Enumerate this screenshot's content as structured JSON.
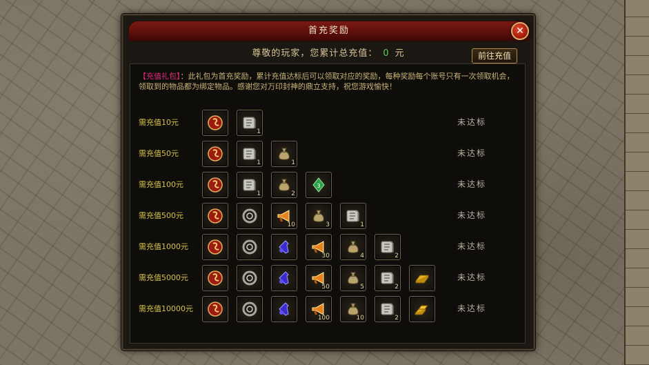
{
  "window": {
    "title": "首充奖励",
    "close_glyph": "✕"
  },
  "summary": {
    "prefix": "尊敬的玩家，您累计总充值：",
    "amount": "0",
    "unit": "元"
  },
  "recharge_button": "前往充值",
  "notice": {
    "tag": "【充值礼包】",
    "text": "：此礼包为首充奖励，累计充值达标后可以领取对应的奖励，每种奖励每个账号只有一次领取机会，领取到的物品都为绑定物品。感谢您对万印封神的鼎立支持，祝您游戏愉快！"
  },
  "colors": {
    "accent_gold": "#d6c44a",
    "highlight_magenta": "#e0287a",
    "amount_green": "#4fd04f",
    "title_red": "#7a1a12"
  },
  "tiers": [
    {
      "req": "需充值10元",
      "status": "未达标",
      "items": [
        {
          "icon": "dragon-seal-icon",
          "count": ""
        },
        {
          "icon": "scroll-icon",
          "count": "1"
        }
      ]
    },
    {
      "req": "需充值50元",
      "status": "未达标",
      "items": [
        {
          "icon": "dragon-seal-icon",
          "count": ""
        },
        {
          "icon": "scroll-icon",
          "count": "1"
        },
        {
          "icon": "money-bag-icon",
          "count": "1"
        }
      ]
    },
    {
      "req": "需充值100元",
      "status": "未达标",
      "items": [
        {
          "icon": "dragon-seal-icon",
          "count": ""
        },
        {
          "icon": "scroll-icon",
          "count": "1"
        },
        {
          "icon": "money-bag-icon",
          "count": "2"
        },
        {
          "icon": "green-gem-icon",
          "count": ""
        }
      ]
    },
    {
      "req": "需充值500元",
      "status": "未达标",
      "items": [
        {
          "icon": "dragon-seal-icon",
          "count": ""
        },
        {
          "icon": "ring-icon",
          "count": ""
        },
        {
          "icon": "horn-icon",
          "count": "10"
        },
        {
          "icon": "money-bag-icon",
          "count": "3"
        },
        {
          "icon": "scroll-icon",
          "count": "1"
        }
      ]
    },
    {
      "req": "需充值1000元",
      "status": "未达标",
      "items": [
        {
          "icon": "dragon-seal-icon",
          "count": ""
        },
        {
          "icon": "ring-icon",
          "count": ""
        },
        {
          "icon": "potion-icon",
          "count": ""
        },
        {
          "icon": "horn-icon",
          "count": "30"
        },
        {
          "icon": "money-bag-icon",
          "count": "4"
        },
        {
          "icon": "scroll-icon",
          "count": "2"
        }
      ]
    },
    {
      "req": "需充值5000元",
      "status": "未达标",
      "items": [
        {
          "icon": "dragon-seal-icon",
          "count": ""
        },
        {
          "icon": "ring-icon",
          "count": ""
        },
        {
          "icon": "potion-icon",
          "count": ""
        },
        {
          "icon": "horn-icon",
          "count": "50"
        },
        {
          "icon": "money-bag-icon",
          "count": "5"
        },
        {
          "icon": "scroll-icon",
          "count": "2"
        },
        {
          "icon": "gold-bar-icon",
          "count": ""
        }
      ]
    },
    {
      "req": "需充值10000元",
      "status": "未达标",
      "items": [
        {
          "icon": "dragon-seal-icon",
          "count": ""
        },
        {
          "icon": "ring-icon",
          "count": ""
        },
        {
          "icon": "potion-icon",
          "count": ""
        },
        {
          "icon": "horn-icon",
          "count": "100"
        },
        {
          "icon": "money-bag-icon",
          "count": "10"
        },
        {
          "icon": "scroll-icon",
          "count": "2"
        },
        {
          "icon": "gold-bars-icon",
          "count": ""
        }
      ]
    }
  ]
}
